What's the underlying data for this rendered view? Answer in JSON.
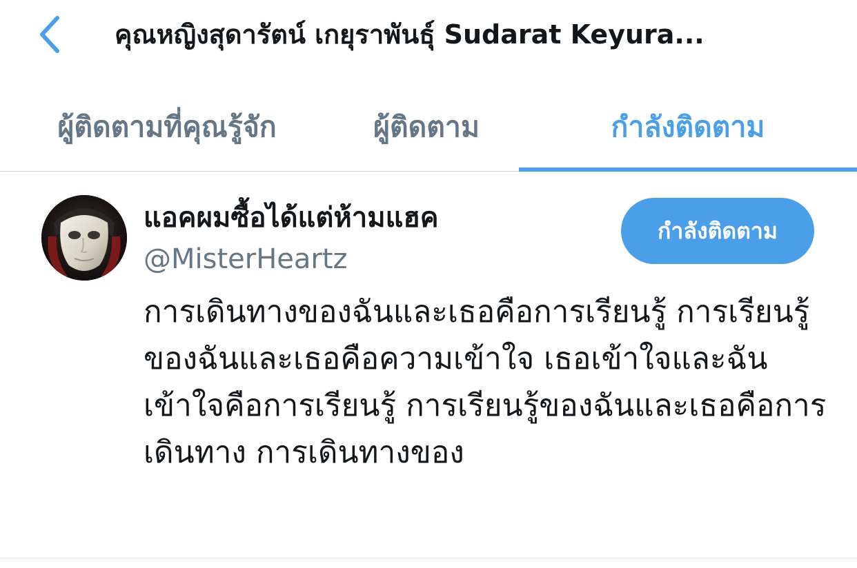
{
  "header": {
    "back_icon": "chevron-left-icon",
    "title": "คุณหญิงสุดารัตน์ เกยุราพันธุ์ Sudarat Keyura..."
  },
  "tabs": [
    {
      "label": "ผู้ติดตามที่คุณรู้จัก",
      "active": false
    },
    {
      "label": "ผู้ติดตาม",
      "active": false
    },
    {
      "label": "กำลังติดตาม",
      "active": true
    }
  ],
  "colors": {
    "accent": "#4a9fe8",
    "text_primary": "#14171a",
    "text_secondary": "#657786"
  },
  "user": {
    "display_name": "แอคผมซื้อได้แต่ห้ามแฮค",
    "handle": "@MisterHeartz",
    "follow_button_label": "กำลังติดตาม",
    "bio": "การเดินทางของฉันและเธอคือการเรียนรู้ การเรียนรู้ของฉันและเธอคือความเข้าใจ เธอเข้าใจและฉันเข้าใจคือการเรียนรู้ การเรียนรู้ของฉันและเธอคือการเดินทาง การเดินทางของ"
  }
}
